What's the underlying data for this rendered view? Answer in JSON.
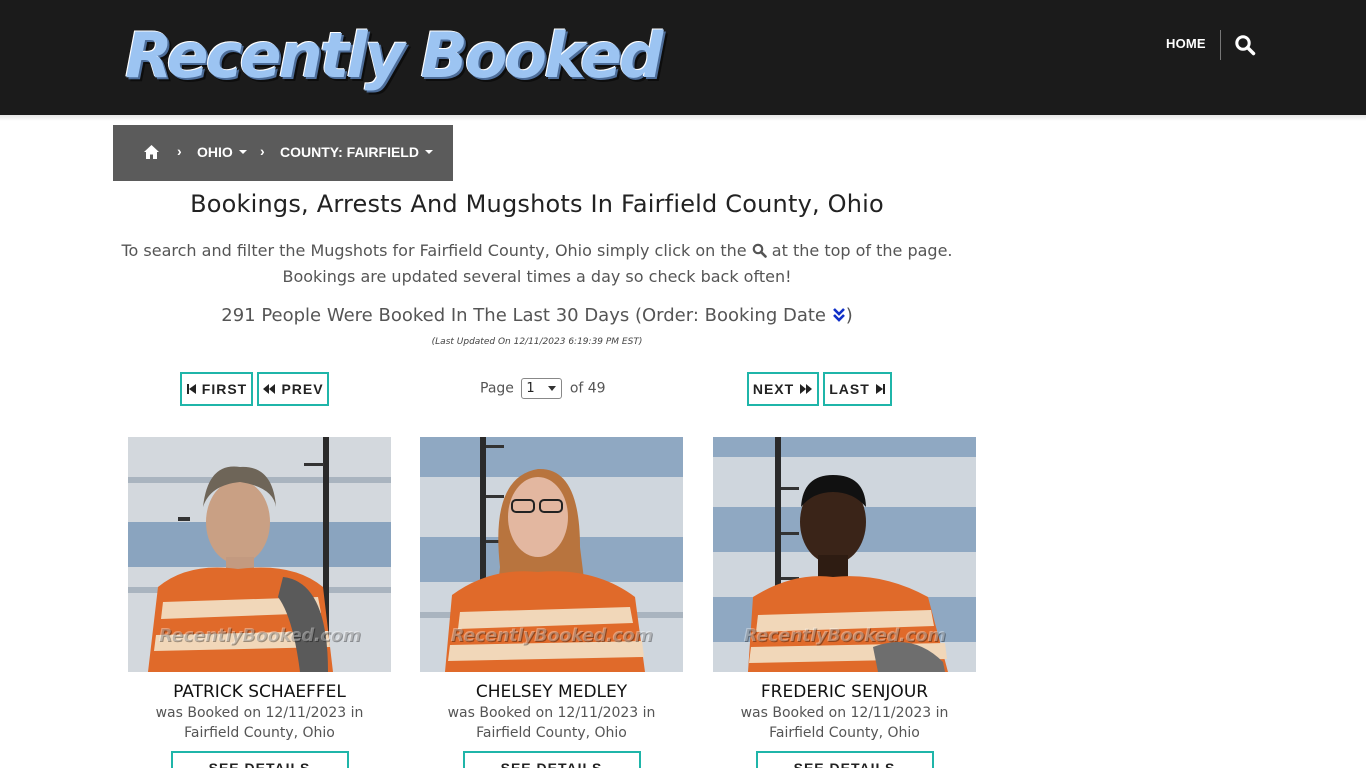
{
  "header": {
    "logo_text": "Recently Booked",
    "nav_home": "HOME",
    "search_icon": "search-icon"
  },
  "breadcrumb": {
    "home_icon": "home-icon",
    "state": "OHIO",
    "county": "COUNTY: FAIRFIELD"
  },
  "main": {
    "title": "Bookings, Arrests And Mugshots In Fairfield County, Ohio",
    "desc_before": "To search and filter the Mugshots for Fairfield County, Ohio simply click on the ",
    "desc_after": " at the top of the page. Bookings are updated several times a day so check back often!",
    "count_text": "291 People Were Booked In The Last 30 Days (Order: Booking Date ",
    "count_close": ")",
    "last_updated": "(Last Updated On 12/11/2023 6:19:39 PM EST)"
  },
  "pagination": {
    "first": "FIRST",
    "prev": "PREV",
    "next": "NEXT",
    "last": "LAST",
    "page_label": "Page",
    "page_value": "1",
    "of_label": "of 49"
  },
  "colors": {
    "header_bg": "#1b1b1b",
    "breadcrumb_bg": "#5b5b5b",
    "accent_teal": "#1fb5a9",
    "order_icon_blue": "#1030c8"
  },
  "bookings": [
    {
      "name": "PATRICK SCHAEFFEL",
      "booked_line1": "was Booked on 12/11/2023 in",
      "booked_line2": "Fairfield County, Ohio",
      "watermark": "RecentlyBooked.com",
      "button": "SEE DETAILS"
    },
    {
      "name": "CHELSEY MEDLEY",
      "booked_line1": "was Booked on 12/11/2023 in",
      "booked_line2": "Fairfield County, Ohio",
      "watermark": "RecentlyBooked.com",
      "button": "SEE DETAILS"
    },
    {
      "name": "FREDERIC SENJOUR",
      "booked_line1": "was Booked on 12/11/2023 in",
      "booked_line2": "Fairfield County, Ohio",
      "watermark": "RecentlyBooked.com",
      "button": "SEE DETAILS"
    }
  ]
}
